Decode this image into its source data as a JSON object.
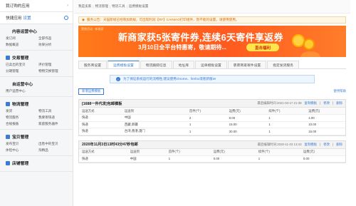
{
  "sidebar": {
    "top_link": "我订购的应用",
    "quick_link": "快捷应用",
    "quick_tag": "设置",
    "sections": [
      {
        "title": "内容运营中心",
        "icon": "content-icon",
        "color": "#ffffff",
        "items": [
          "发订阅",
          "全部作品",
          "数据概览",
          "效果分析"
        ]
      },
      {
        "title": "交易管理",
        "icon": "trade-icon",
        "color": "#3a7bd5",
        "items": [
          "已卖出的宝贝",
          "评价管理",
          "分期管理",
          "物物交换管理"
        ]
      },
      {
        "title": "自运营中心",
        "icon": "self-ops-icon",
        "color": "#ffffff",
        "items": [
          "用户运营中心"
        ]
      },
      {
        "title": "物流管理",
        "icon": "logistics-icon",
        "color": "#3a7bd5",
        "items": [
          "发货",
          "物流工具",
          "物流服务",
          "我要寄快递",
          "合规报备",
          "家庭服务器件"
        ]
      },
      {
        "title": "宝贝管理",
        "icon": "goods-icon",
        "color": "#3a7bd5",
        "items": [
          "发布宝贝",
          "出售中的宝贝",
          "体检中心",
          "淘精品"
        ]
      },
      {
        "title": "店铺管理",
        "icon": "shop-icon",
        "color": "#3a7bd5",
        "items": []
      }
    ]
  },
  "breadcrumb": [
    "我是卖家",
    "物流管理",
    "物流工具",
    "运费模板设置"
  ],
  "notice": "服务公告：天猫新规已经增加新规，可出现利润【RF】CAINIAO打印组件，暂不能的设置，请使用使用。",
  "banner": {
    "small_label": "营销活动 · 新商家",
    "headline": "新商家获5张寄件券,连续6天寄件享返券",
    "subline": "3月10日全平台特惠寄，敬请期待...",
    "button": "直击福利"
  },
  "tabs": [
    "服务商设置",
    "运费模板设置",
    "物流跟踪信息",
    "地址库",
    "运单模板设置",
    "裹裹商家寄件设置",
    "指定发货服务"
  ],
  "active_tab": 1,
  "hint": "为了保证系统运行的流畅性,建议使用chrome、firefox或者新版ie!",
  "new_template_button": "新增运费模板",
  "help_link": "使用帮助",
  "templates": [
    {
      "title": "[1688一件代发]包邮模板",
      "modified": "最后编辑时间:2021-03-17 21:38",
      "actions": [
        "复制模板",
        "修改",
        "删除"
      ],
      "columns": [
        "运送方式",
        "运送到",
        "首件(个)",
        "运费(元)",
        "续件(个)",
        "运费(元)"
      ],
      "rows": [
        [
          "快递",
          "中国",
          "2",
          "8.00",
          "1",
          "4.00"
        ],
        [
          "快递",
          "西藏,新疆",
          "1",
          "15.00",
          "1",
          "10.00"
        ],
        [
          "快递",
          "台湾,香港,澳门",
          "1",
          "30.00",
          "1",
          "15.00"
        ]
      ]
    },
    {
      "title": "2020年11月3日13时43分47秒包邮",
      "modified": "最后编辑时间:2020-11-03 13:43",
      "actions": [
        "复制模板",
        "修改",
        "删除"
      ],
      "columns": [
        "运送方式",
        "运送到",
        "首件(个)",
        "运费(元)",
        "续件(个)",
        "运费(元)"
      ],
      "rows": [
        [
          "快递",
          "中国",
          "1",
          "0.00",
          "1",
          "0.00"
        ]
      ]
    }
  ]
}
